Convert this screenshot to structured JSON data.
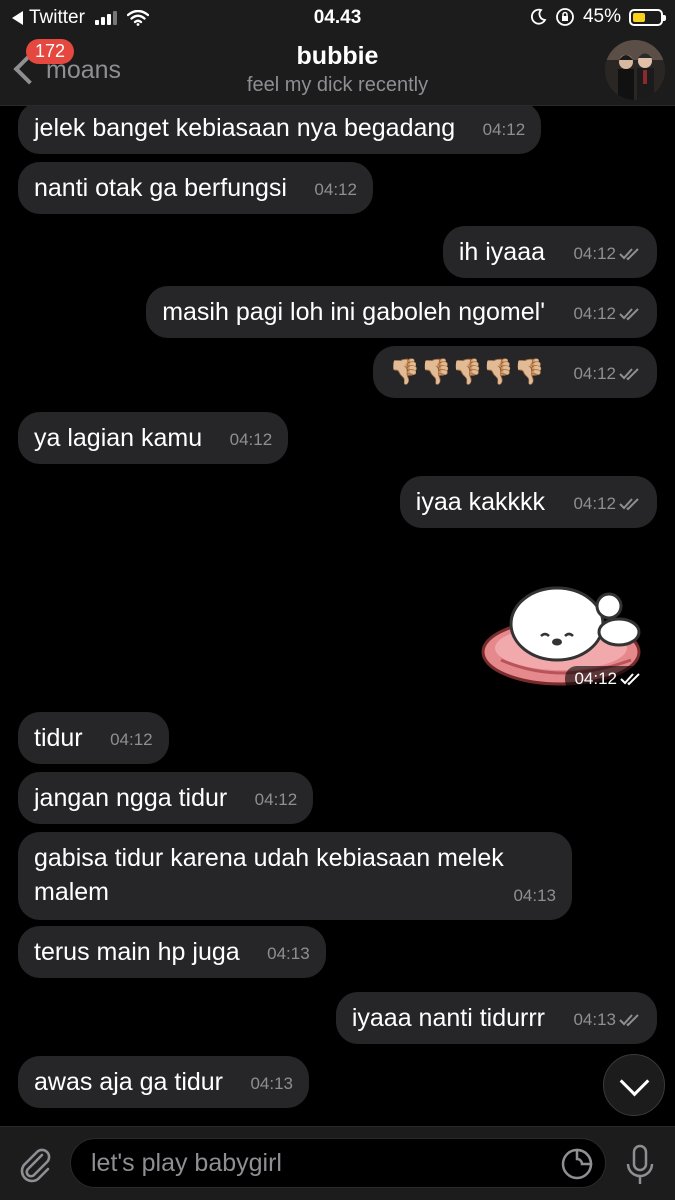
{
  "status_bar": {
    "carrier": "Twitter",
    "time": "04.43",
    "battery_percent": "45%",
    "battery_level": 0.45,
    "battery_color": "#f7d21c"
  },
  "header": {
    "back_label": "moans",
    "unread_count": "172",
    "title": "bubbie",
    "subtitle": "feel my dick recently"
  },
  "messages": [
    {
      "dir": "in",
      "text": "jelek banget kebiasaan nya begadang",
      "time": "04:12"
    },
    {
      "dir": "in",
      "text": "nanti otak ga berfungsi",
      "time": "04:12"
    },
    {
      "dir": "out",
      "text": "ih iyaaa",
      "time": "04:12"
    },
    {
      "dir": "out",
      "text": "masih pagi loh ini gaboleh ngomel'",
      "time": "04:12"
    },
    {
      "dir": "out",
      "text": "👎🏼👎🏼👎🏼👎🏼👎🏼",
      "time": "04:12"
    },
    {
      "dir": "in",
      "text": "ya lagian kamu",
      "time": "04:12"
    },
    {
      "dir": "out",
      "text": "iyaa kakkkk",
      "time": "04:12"
    },
    {
      "dir": "out",
      "sticker": "sleeping-bear-sticker",
      "time": "04:12"
    },
    {
      "dir": "in",
      "text": "tidur",
      "time": "04:12"
    },
    {
      "dir": "in",
      "text": "jangan ngga tidur",
      "time": "04:12"
    },
    {
      "dir": "in",
      "text": "gabisa tidur karena udah kebiasaan melek malem",
      "time": "04:13"
    },
    {
      "dir": "in",
      "text": "terus main hp juga",
      "time": "04:13"
    },
    {
      "dir": "out",
      "text": "iyaaa nanti tidurrr",
      "time": "04:13"
    },
    {
      "dir": "in",
      "text": "awas aja ga tidur",
      "time": "04:13"
    }
  ],
  "input": {
    "placeholder": "let's play babygirl"
  },
  "icons": [
    "back-chevron-icon",
    "signal-icon",
    "wifi-icon",
    "moon-icon",
    "rotation-lock-icon",
    "battery-icon",
    "paperclip-icon",
    "sticker-icon",
    "microphone-icon",
    "chevron-down-icon",
    "double-check-icon"
  ],
  "colors": {
    "background": "#000000",
    "bubble": "#262628",
    "bar": "#1c1c1d",
    "badge": "#e5483f",
    "muted": "#8e8e93"
  }
}
